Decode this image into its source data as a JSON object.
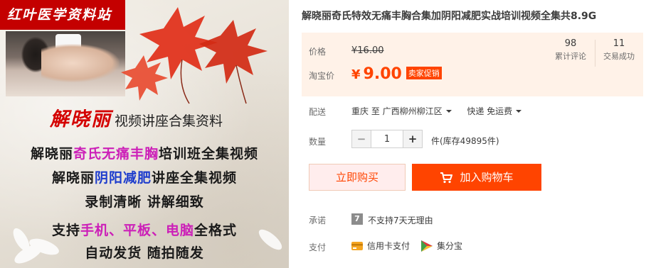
{
  "gallery": {
    "brand_banner": "红叶医学资料站",
    "headline_highlight": "解晓丽",
    "headline_rest": "视频讲座合集资料",
    "line1": {
      "a": "解晓丽",
      "b": "奇氏无痛丰胸",
      "c": "培训班全集视频"
    },
    "line2": {
      "a": "解晓丽",
      "b": "阴阳减肥",
      "c": "讲座全集视频"
    },
    "line3": "录制清晰 讲解细致",
    "line4": {
      "a": "支持",
      "b": "手机、平板、电脑",
      "c": "全格式"
    },
    "line5": "自动发货 随拍随发"
  },
  "product": {
    "title": "解晓丽奇氏特效无痛丰胸合集加阴阳减肥实战培训视频全集共8.9G"
  },
  "price": {
    "original_label": "价格",
    "original_value": "¥16.00",
    "taobao_label": "淘宝价",
    "currency": "¥",
    "sale_value": "9.00",
    "promo_badge": "卖家促销"
  },
  "stats": {
    "reviews_count": "98",
    "reviews_label": "累计评论",
    "deals_count": "11",
    "deals_label": "交易成功"
  },
  "delivery": {
    "label": "配送",
    "from": "重庆 至",
    "to": "广西柳州柳江区",
    "shipping": "快递 免运费"
  },
  "quantity": {
    "label": "数量",
    "minus": "−",
    "value": "1",
    "plus": "+",
    "stock": "件(库存49895件)"
  },
  "actions": {
    "buy_now": "立即购买",
    "add_to_cart": "加入购物车"
  },
  "promise": {
    "label": "承诺",
    "icon_glyph": "7",
    "text": "不支持7天无理由"
  },
  "payment": {
    "label": "支付",
    "credit_card": "信用卡支付",
    "jifenbao": "集分宝"
  },
  "colors": {
    "accent": "#ff4400",
    "price_panel_bg": "#fff2e8",
    "banner_red": "#c40000"
  }
}
